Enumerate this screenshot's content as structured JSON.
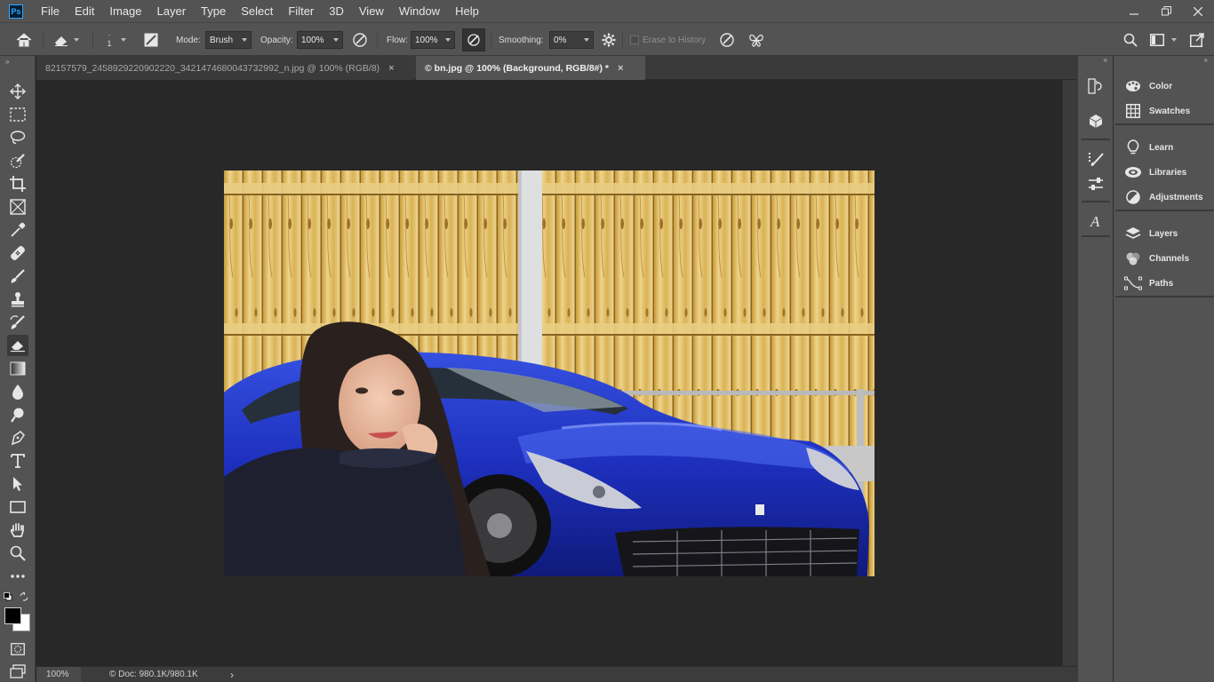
{
  "app": {
    "logo_text": "Ps"
  },
  "menu": [
    "File",
    "Edit",
    "Image",
    "Layer",
    "Type",
    "Select",
    "Filter",
    "3D",
    "View",
    "Window",
    "Help"
  ],
  "options": {
    "brush_size": "1",
    "mode_label": "Mode:",
    "mode_value": "Brush",
    "opacity_label": "Opacity:",
    "opacity_value": "100%",
    "flow_label": "Flow:",
    "flow_value": "100%",
    "smoothing_label": "Smoothing:",
    "smoothing_value": "0%",
    "erase_history_label": "Erase to History"
  },
  "tabs": [
    {
      "label": "82157579_2458929220902220_3421474680043732992_n.jpg @ 100% (RGB/8)",
      "close": "×"
    },
    {
      "label": "© bn.jpg @ 100% (Background, RGB/8#) *",
      "close": "×"
    }
  ],
  "status": {
    "zoom": "100%",
    "doc": "© Doc: 980.1K/980.1K",
    "arrow": "›"
  },
  "panels": {
    "group1": [
      "Color",
      "Swatches"
    ],
    "group2": [
      "Learn",
      "Libraries",
      "Adjustments"
    ],
    "group3": [
      "Layers",
      "Channels",
      "Paths"
    ]
  },
  "colors": {
    "ui_bg": "#535353",
    "canvas_bg": "#282828",
    "accent": "#31a8ff",
    "fence": "#e2c77c",
    "car": "#1b2fb8"
  }
}
